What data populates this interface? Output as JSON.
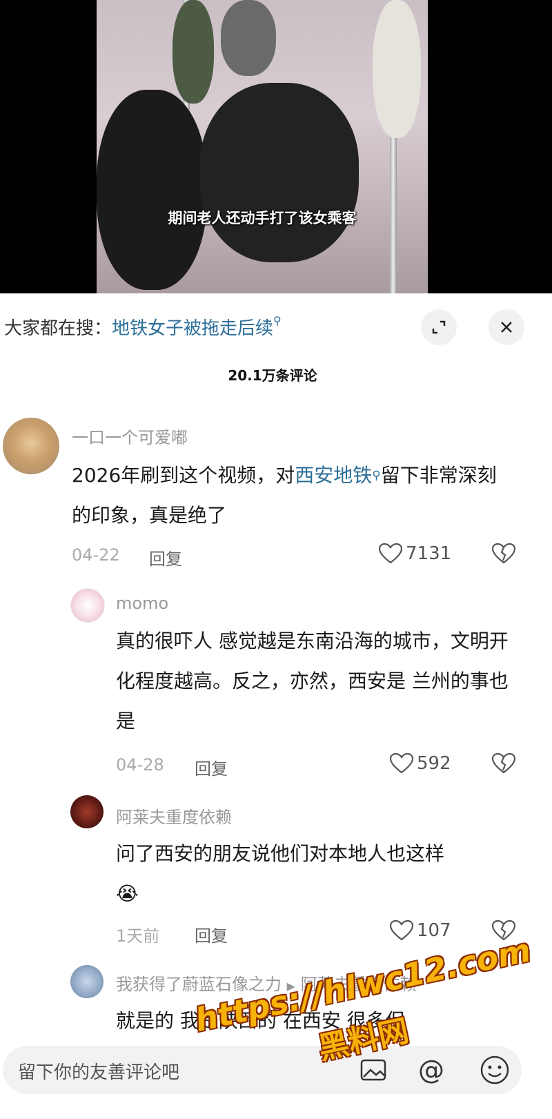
{
  "video": {
    "caption": "期间老人还动手打了该女乘客"
  },
  "search": {
    "prefix": "大家都在搜：",
    "query": "地铁女子被拖走后续"
  },
  "header": {
    "comment_count": "20.1万条评论"
  },
  "comments": [
    {
      "username": "一口一个可爱嘟",
      "text_before": "2026年刷到这个视频，对",
      "link": "西安地铁",
      "text_after": "留下非常深刻的印象，真是绝了",
      "date": "04-22",
      "reply_label": "回复",
      "likes": "7131"
    },
    {
      "username": "momo",
      "text": "真的很吓人 感觉越是东南沿海的城市，文明开化程度越高。反之，亦然，西安是 兰州的事也是",
      "date": "04-28",
      "reply_label": "回复",
      "likes": "592"
    },
    {
      "username": "阿莱夫重度依赖",
      "text": "问了西安的朋友说他们对本地人也这样",
      "emoji": "😭",
      "date": "1天前",
      "reply_label": "回复",
      "likes": "107"
    },
    {
      "username": "我获得了蔚蓝石像之力",
      "reply_to": "阿莱夫重度依赖",
      "text": "就是的 我是陕西的 在西安 很多保"
    }
  ],
  "input": {
    "placeholder": "留下你的友善评论吧"
  },
  "watermark": {
    "url": "https://hlwc12.com",
    "name": "黑料网"
  }
}
